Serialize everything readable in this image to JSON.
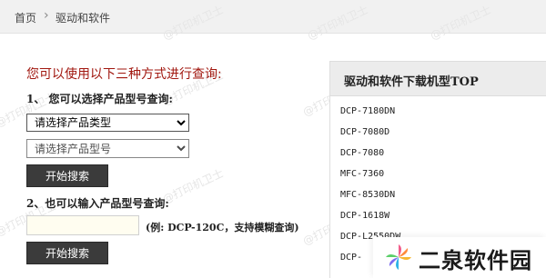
{
  "breadcrumb": {
    "home": "首页",
    "separator": "›",
    "current": "驱动和软件"
  },
  "watermark_text": "@打印机卫士",
  "query": {
    "heading": "您可以使用以下三种方式进行查询:",
    "step1_label": "1、 您可以选择产品型号查询:",
    "type_select_value": "请选择产品类型",
    "model_select_value": "请选择产品型号",
    "search_button": "开始搜索",
    "step2_label": "2、也可以输入产品型号查询:",
    "model_input_value": "",
    "hint": "(例: DCP-120C，支持模糊查询)",
    "search_button2": "开始搜索"
  },
  "top_panel": {
    "title": "驱动和软件下载机型TOP",
    "items": [
      "DCP-7180DN",
      "DCP-7080D",
      "DCP-7080",
      "MFC-7360",
      "MFC-8530DN",
      "DCP-1618W",
      "DCP-L2550DW",
      "DCP-"
    ]
  },
  "badge": {
    "text": "二泉软件园"
  },
  "colors": {
    "heading_red": "#a1170f",
    "button_bg": "#3b3b3b",
    "header_bg": "#f1f1f1"
  }
}
